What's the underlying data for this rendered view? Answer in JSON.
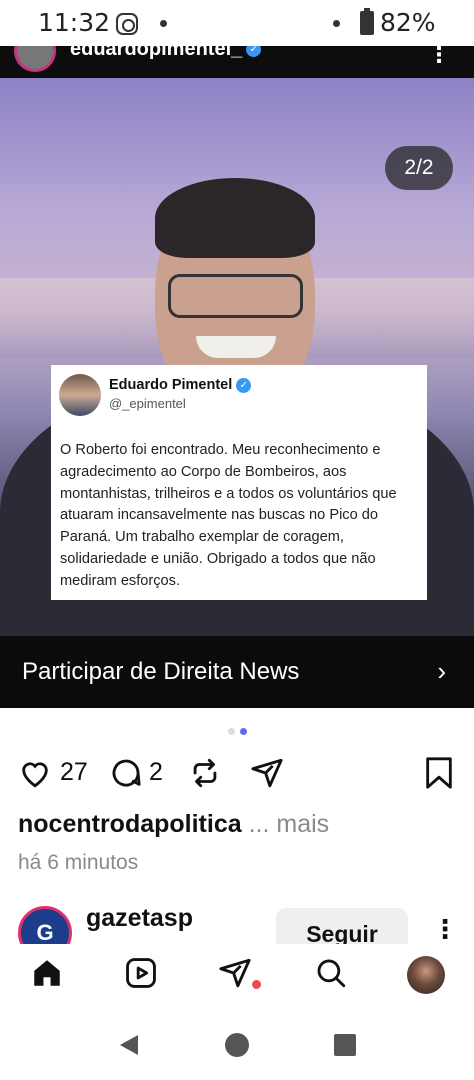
{
  "status_bar": {
    "time": "11:32",
    "battery": "82%"
  },
  "post": {
    "author": "eduardopimentel_",
    "page_indicator": "2/2",
    "tweet": {
      "name": "Eduardo Pimentel",
      "handle": "@_epimentel",
      "text": "O Roberto foi encontrado. Meu reconhecimento e agradecimento ao Corpo de Bombeiros, aos montanhistas, trilheiros e a todos os voluntários que atuaram incansavelmente nas buscas no Pico do Paraná. Um trabalho exemplar de coragem, solidariedade e união. Obrigado a todos que não mediram esforços."
    },
    "cta_label": "Participar de Direita News",
    "likes": "27",
    "comments": "2",
    "caption_user": "nocentrodapolitica",
    "caption_more": "... mais",
    "time_ago": "há 6 minutos"
  },
  "next_post": {
    "user": "gazetasp",
    "follow_label": "Seguir"
  },
  "colors": {
    "accent": "#3897f0",
    "notification": "#ed4956",
    "carousel_active": "#5b6cf0"
  },
  "icons": {
    "like": "heart-icon",
    "comment": "comment-icon",
    "repost": "repost-icon",
    "share": "send-icon",
    "save": "bookmark-icon",
    "home": "home-icon",
    "reels": "reels-icon",
    "direct": "direct-icon",
    "search": "search-icon",
    "audio": "speaker-icon"
  }
}
